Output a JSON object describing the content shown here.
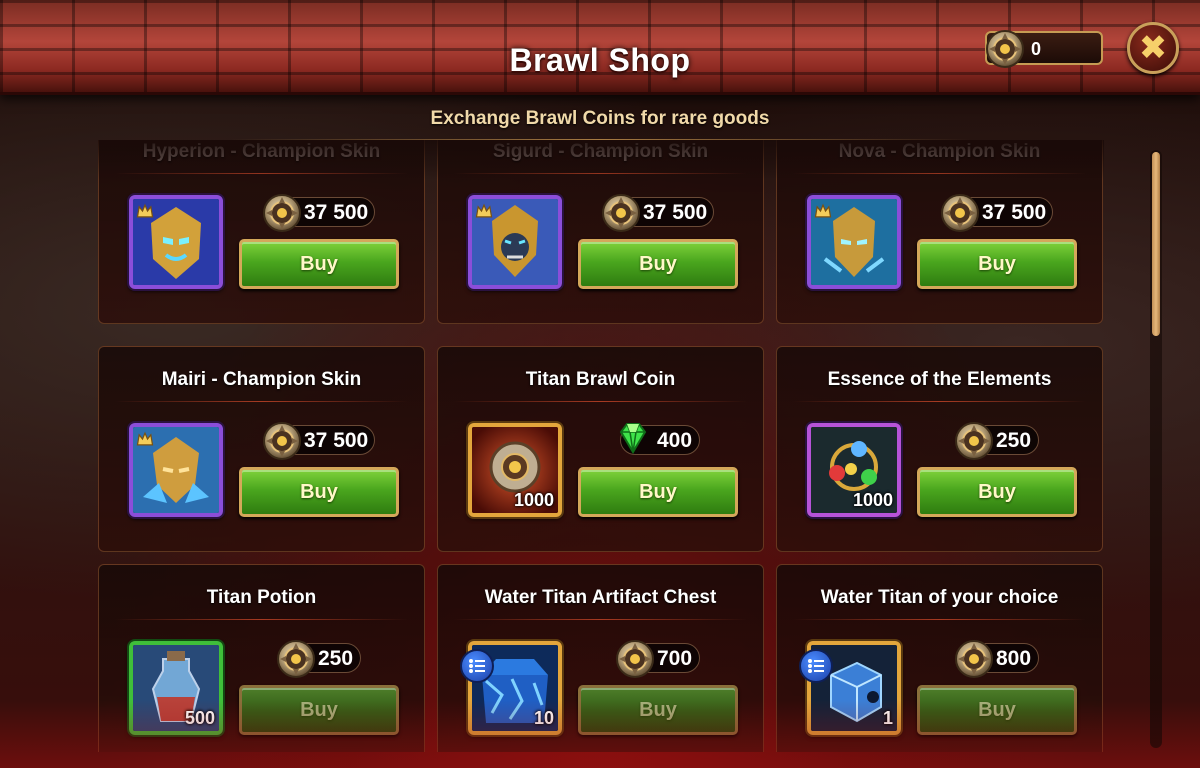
{
  "header": {
    "title": "Brawl Shop",
    "currency_value": "0",
    "close_icon": "close-x-icon"
  },
  "subtitle": "Exchange Brawl Coins for rare goods",
  "colors": {
    "buy_green": "#4aa61e",
    "gold_border": "#d4a85a",
    "title_text": "#ffffff",
    "subtitle_text": "#f1d9a9"
  },
  "items": [
    {
      "name": "Hyperion - Champion Skin",
      "price": "37 500",
      "currency": "brawl-coin-icon",
      "button": "Buy",
      "icon": "hyperion-skin-icon"
    },
    {
      "name": "Sigurd - Champion Skin",
      "price": "37 500",
      "currency": "brawl-coin-icon",
      "button": "Buy",
      "icon": "sigurd-skin-icon"
    },
    {
      "name": "Nova - Champion Skin",
      "price": "37 500",
      "currency": "brawl-coin-icon",
      "button": "Buy",
      "icon": "nova-skin-icon"
    },
    {
      "name": "Mairi - Champion Skin",
      "price": "37 500",
      "currency": "brawl-coin-icon",
      "button": "Buy",
      "icon": "mairi-skin-icon"
    },
    {
      "name": "Titan Brawl Coin",
      "price": "400",
      "currency": "emerald-icon",
      "button": "Buy",
      "icon": "titan-brawl-coin-icon",
      "quantity": "1000"
    },
    {
      "name": "Essence of the Elements",
      "price": "250",
      "currency": "brawl-coin-icon",
      "button": "Buy",
      "icon": "essence-elements-icon",
      "quantity": "1000"
    },
    {
      "name": "Titan Potion",
      "price": "250",
      "currency": "brawl-coin-icon",
      "button": "Buy",
      "icon": "titan-potion-icon",
      "quantity": "500"
    },
    {
      "name": "Water Titan Artifact Chest",
      "price": "700",
      "currency": "brawl-coin-icon",
      "button": "Buy",
      "icon": "water-artifact-chest-icon",
      "quantity": "10"
    },
    {
      "name": "Water Titan of your choice",
      "price": "800",
      "currency": "brawl-coin-icon",
      "button": "Buy",
      "icon": "water-titan-choice-icon",
      "quantity": "1"
    }
  ]
}
